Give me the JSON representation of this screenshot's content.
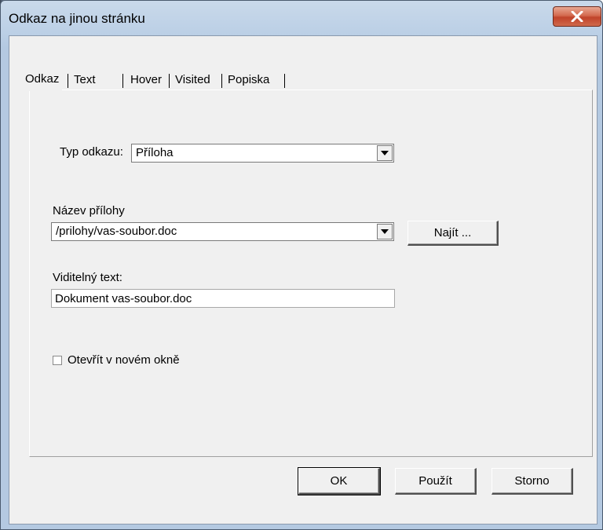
{
  "window": {
    "title": "Odkaz na jinou stránku",
    "close_label": "X"
  },
  "tabs": [
    {
      "label": "Odkaz",
      "active": true
    },
    {
      "label": "Text",
      "active": false
    },
    {
      "label": "Hover",
      "active": false
    },
    {
      "label": "Visited",
      "active": false
    },
    {
      "label": "Popiska",
      "active": false
    }
  ],
  "form": {
    "link_type_label": "Typ odkazu:",
    "link_type_value": "Příloha",
    "attachment_label": "Název přílohy",
    "attachment_value": "/prilohy/vas-soubor.doc",
    "find_button": "Najít ...",
    "visible_text_label": "Viditelný text:",
    "visible_text_value": "Dokument vas-soubor.doc",
    "new_window_label": "Otevřít v novém okně",
    "new_window_checked": false
  },
  "footer": {
    "ok": "OK",
    "apply": "Použít",
    "cancel": "Storno"
  }
}
